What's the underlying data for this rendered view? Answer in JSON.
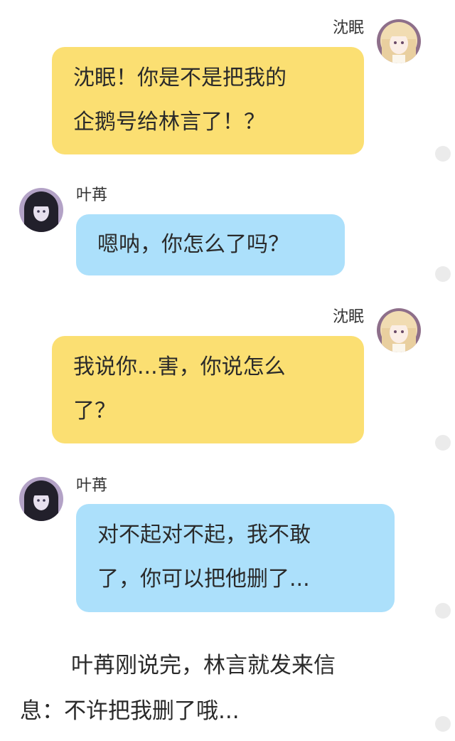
{
  "messages": [
    {
      "side": "right",
      "sender": "沈眠",
      "avatar_icon": "anime-girl-blonde-avatar",
      "lines": [
        "沈眠！你是不是把我的",
        "企鹅号给林言了！？"
      ]
    },
    {
      "side": "left",
      "sender": "叶苒",
      "avatar_icon": "anime-girl-dark-hair-avatar",
      "lines": [
        "嗯呐，你怎么了吗？"
      ]
    },
    {
      "side": "right",
      "sender": "沈眠",
      "avatar_icon": "anime-girl-blonde-avatar",
      "lines": [
        "我说你...害，你说怎么",
        "了？"
      ]
    },
    {
      "side": "left",
      "sender": "叶苒",
      "avatar_icon": "anime-girl-dark-hair-avatar",
      "lines": [
        "对不起对不起，我不敢",
        "了，你可以把他删了..."
      ]
    }
  ],
  "narration": {
    "lines": [
      "叶苒刚说完，林言就发来信",
      "息：不许把我删了哦..."
    ]
  },
  "colors": {
    "right_bubble": "#fbdf72",
    "left_bubble": "#ace0fb",
    "side_dot": "#ebebeb"
  }
}
